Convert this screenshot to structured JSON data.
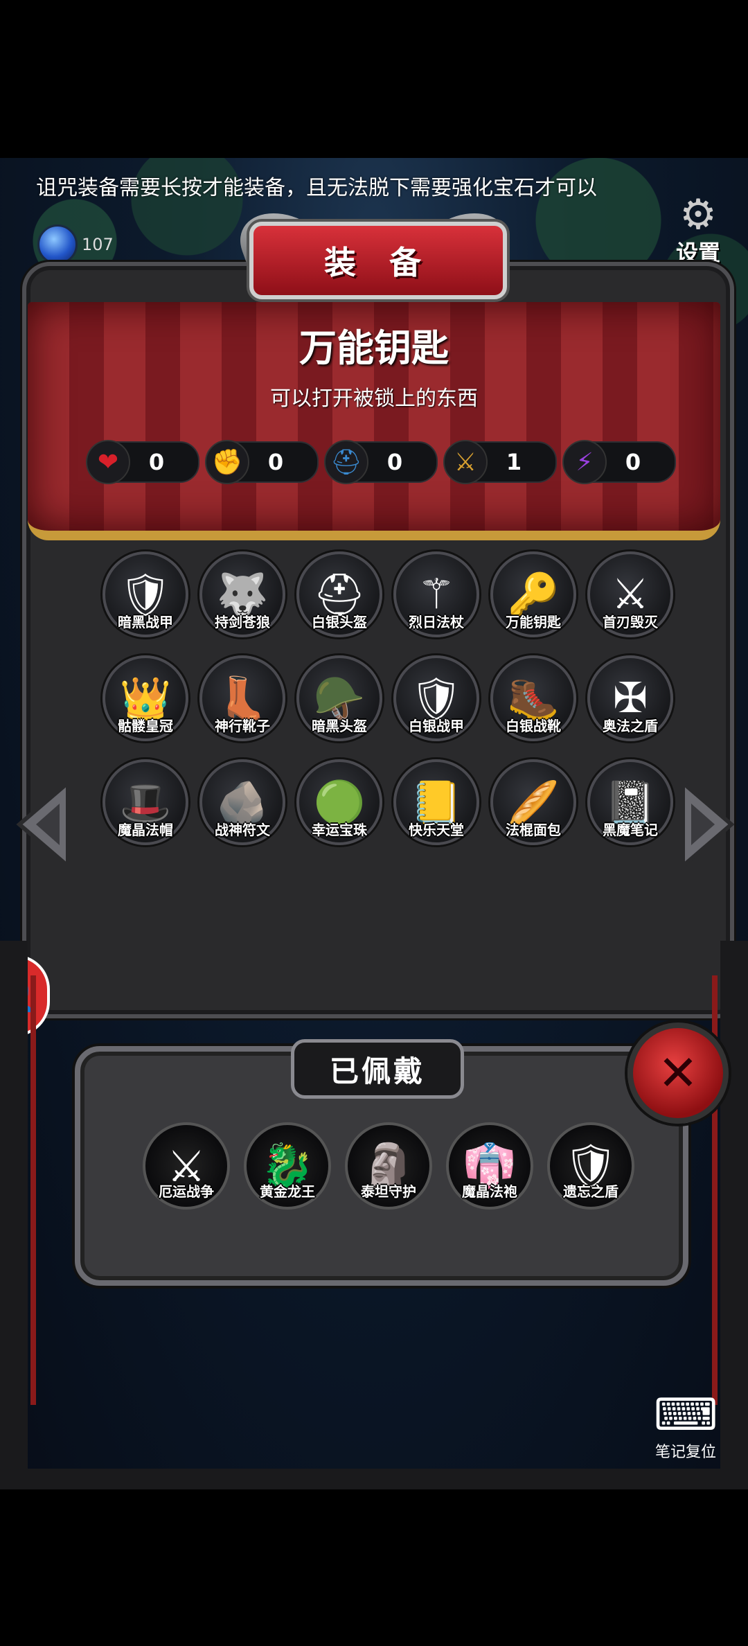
{
  "top_notice": "诅咒装备需要长按才能装备，且无法脱下需要强化宝石才可以",
  "gems": {
    "count": "107"
  },
  "settings": {
    "label": "设置"
  },
  "title": "装 备",
  "selected_item": {
    "name": "万能钥匙",
    "description": "可以打开被锁上的东西"
  },
  "stats": [
    {
      "icon": "heart-icon",
      "value": "0",
      "color": "#d8202a"
    },
    {
      "icon": "strength-icon",
      "value": "0",
      "color": "#e0c020"
    },
    {
      "icon": "helmet-icon",
      "value": "0",
      "color": "#3a8ad0"
    },
    {
      "icon": "sword-icon",
      "value": "1",
      "color": "#d8a030"
    },
    {
      "icon": "lightning-icon",
      "value": "0",
      "color": "#9a40e0"
    }
  ],
  "inventory": [
    {
      "label": "暗黑战甲",
      "icon": "dark-armor-icon"
    },
    {
      "label": "持剑苍狼",
      "icon": "sword-wolf-icon"
    },
    {
      "label": "白银头盔",
      "icon": "silver-helmet-icon"
    },
    {
      "label": "烈日法杖",
      "icon": "sun-staff-icon"
    },
    {
      "label": "万能钥匙",
      "icon": "master-key-icon"
    },
    {
      "label": "首刃毁灭",
      "icon": "blade-destroy-icon"
    },
    {
      "label": "骷髅皇冠",
      "icon": "skull-crown-icon"
    },
    {
      "label": "神行靴子",
      "icon": "swift-boots-icon"
    },
    {
      "label": "暗黑头盔",
      "icon": "dark-helmet-icon"
    },
    {
      "label": "白银战甲",
      "icon": "silver-armor-icon"
    },
    {
      "label": "白银战靴",
      "icon": "silver-boots-icon"
    },
    {
      "label": "奥法之盾",
      "icon": "arcane-shield-icon"
    },
    {
      "label": "魔晶法帽",
      "icon": "wizard-hat-icon"
    },
    {
      "label": "战神符文",
      "icon": "war-rune-icon"
    },
    {
      "label": "幸运宝珠",
      "icon": "lucky-orb-icon"
    },
    {
      "label": "快乐天堂",
      "icon": "happy-heaven-icon"
    },
    {
      "label": "法棍面包",
      "icon": "baguette-icon"
    },
    {
      "label": "黑魔笔记",
      "icon": "dark-notebook-icon"
    }
  ],
  "equipped": {
    "title": "已佩戴",
    "items": [
      {
        "label": "厄运战争",
        "icon": "doom-war-icon"
      },
      {
        "label": "黄金龙王",
        "icon": "golden-dragon-icon"
      },
      {
        "label": "泰坦守护",
        "icon": "titan-guard-icon"
      },
      {
        "label": "魔晶法袍",
        "icon": "crystal-robe-icon"
      },
      {
        "label": "遗忘之盾",
        "icon": "forgotten-shield-icon"
      }
    ]
  },
  "reset": {
    "label": "笔记复位"
  }
}
